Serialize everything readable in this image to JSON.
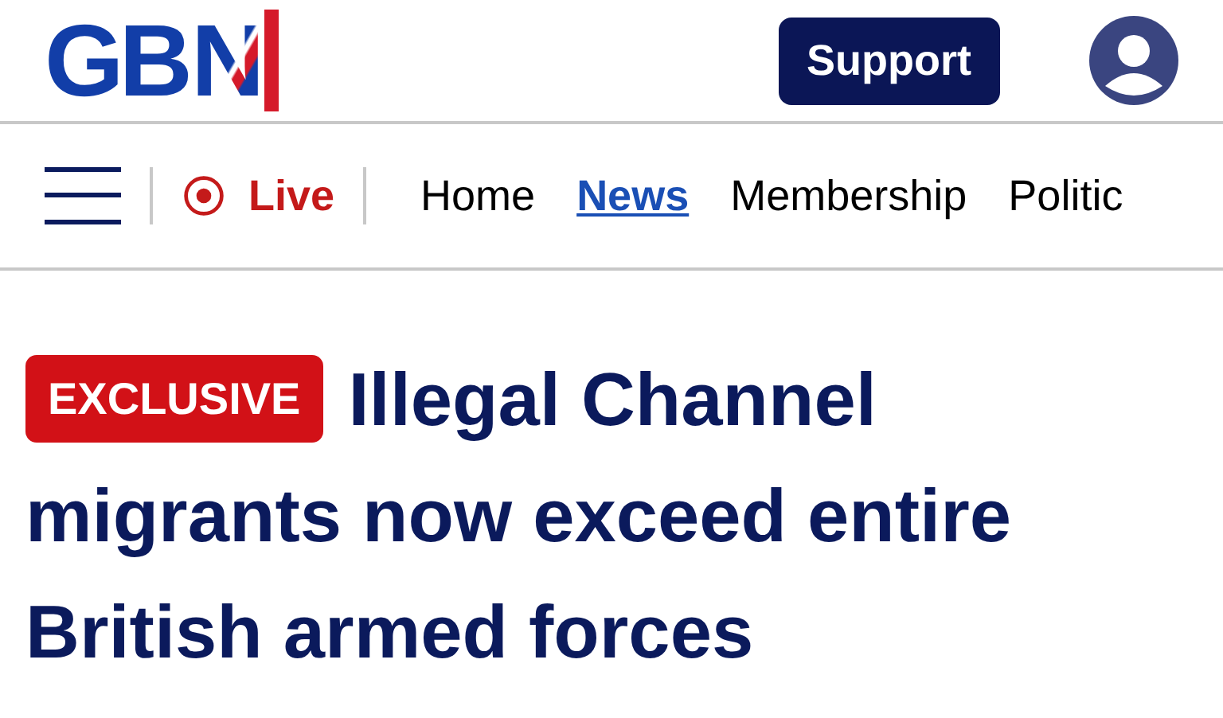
{
  "logo": {
    "text": "GB",
    "mark": "N"
  },
  "support_button": "Support",
  "nav": {
    "live": "Live",
    "items": [
      {
        "label": "Home",
        "selected": false
      },
      {
        "label": "News",
        "selected": true
      },
      {
        "label": "Membership",
        "selected": false
      },
      {
        "label": "Politic",
        "selected": false
      }
    ]
  },
  "article": {
    "badge": "EXCLUSIVE",
    "headline_lines": [
      "Illegal Channel",
      "migrants now exceed entire",
      "British armed forces"
    ]
  }
}
